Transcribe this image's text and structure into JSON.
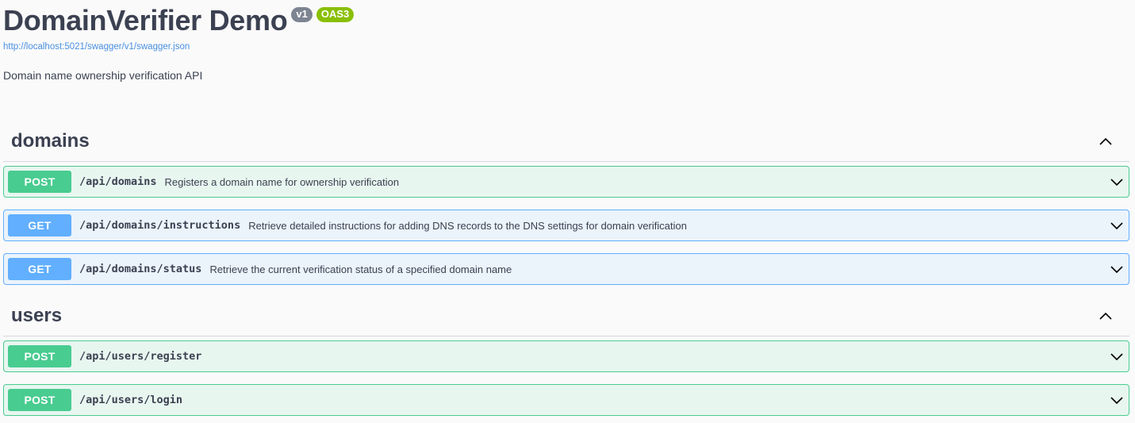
{
  "info": {
    "title": "DomainVerifier Demo",
    "version_badge": "v1",
    "spec_badge": "OAS3",
    "spec_url": "http://localhost:5021/swagger/v1/swagger.json",
    "description": "Domain name ownership verification API"
  },
  "tags": [
    {
      "name": "domains",
      "operations": [
        {
          "method": "POST",
          "path": "/api/domains",
          "summary": "Registers a domain name for ownership verification"
        },
        {
          "method": "GET",
          "path": "/api/domains/instructions",
          "summary": "Retrieve detailed instructions for adding DNS records to the DNS settings for domain verification"
        },
        {
          "method": "GET",
          "path": "/api/domains/status",
          "summary": "Retrieve the current verification status of a specified domain name"
        }
      ]
    },
    {
      "name": "users",
      "operations": [
        {
          "method": "POST",
          "path": "/api/users/register",
          "summary": ""
        },
        {
          "method": "POST",
          "path": "/api/users/login",
          "summary": ""
        }
      ]
    }
  ],
  "colors": {
    "post": "#49cc90",
    "get": "#61affe",
    "badge_version": "#7d8492",
    "badge_spec": "#89bf04"
  }
}
